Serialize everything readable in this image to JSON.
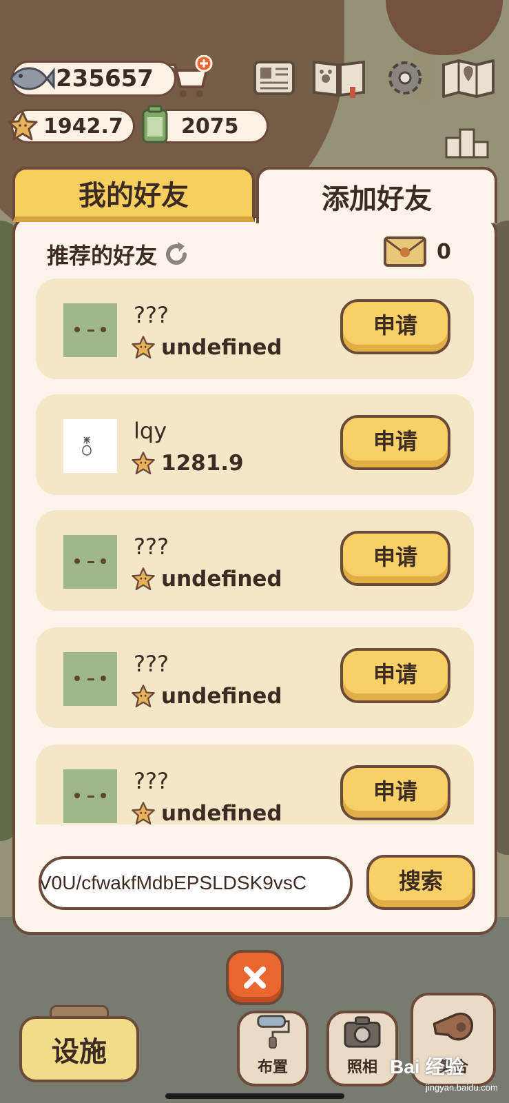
{
  "hud": {
    "fish_count": "235657",
    "star_count": "1942.7",
    "battery_count": "2075"
  },
  "tabs": {
    "friends_label": "我的好友",
    "add_label": "添加好友"
  },
  "recommended": {
    "title": "推荐的好友",
    "envelope_count": "0"
  },
  "friends": [
    {
      "name": "???",
      "score": "undefined",
      "button": "申请"
    },
    {
      "name": "lqy",
      "score": "1281.9",
      "button": "申请"
    },
    {
      "name": "???",
      "score": "undefined",
      "button": "申请"
    },
    {
      "name": "???",
      "score": "undefined",
      "button": "申请"
    },
    {
      "name": "???",
      "score": "undefined",
      "button": "申请"
    }
  ],
  "search": {
    "value": "V0U/cfwakfMdbEPSLDSK9vsC",
    "button": "搜索"
  },
  "toolbar": {
    "facility": "设施",
    "layout": "布置",
    "photo": "照相",
    "gather": "集合"
  },
  "watermark": {
    "main": "Bai 经验",
    "url": "jingyan.baidu.com"
  }
}
